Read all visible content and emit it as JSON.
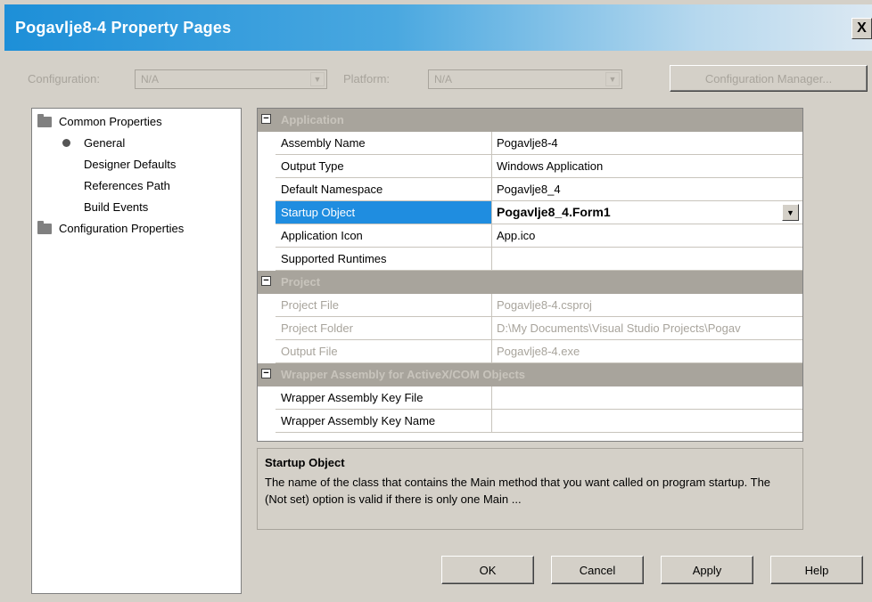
{
  "window": {
    "title": "Pogavlje8-4 Property Pages",
    "close_glyph": "X"
  },
  "toolbar": {
    "configuration_label": "Configuration:",
    "configuration_value": "N/A",
    "platform_label": "Platform:",
    "platform_value": "N/A",
    "config_manager_label": "Configuration Manager..."
  },
  "tree": {
    "items": [
      {
        "label": "Common Properties",
        "icon": "folder-icon"
      },
      {
        "label": "General",
        "icon": "bullet-icon"
      },
      {
        "label": "Designer Defaults"
      },
      {
        "label": "References Path"
      },
      {
        "label": "Build Events"
      },
      {
        "label": "Configuration Properties",
        "icon": "folder-icon"
      }
    ]
  },
  "grid": {
    "categories": [
      {
        "name": "Application",
        "expander": "⊟",
        "rows": [
          {
            "name": "Assembly Name",
            "value": "Pogavlje8-4"
          },
          {
            "name": "Output Type",
            "value": "Windows Application"
          },
          {
            "name": "Default Namespace",
            "value": "Pogavlje8_4"
          },
          {
            "name": "Startup Object",
            "value": "Pogavlje8_4.Form1",
            "selected": true
          },
          {
            "name": "Application Icon",
            "value": "App.ico"
          },
          {
            "name": "Supported Runtimes",
            "value": ""
          }
        ]
      },
      {
        "name": "Project",
        "expander": "⊟",
        "rows": [
          {
            "name": "Project File",
            "value": "Pogavlje8-4.csproj"
          },
          {
            "name": "Project Folder",
            "value": "D:\\My Documents\\Visual Studio Projects\\Pogav"
          },
          {
            "name": "Output File",
            "value": "Pogavlje8-4.exe"
          }
        ]
      },
      {
        "name": "Wrapper Assembly for ActiveX/COM Objects",
        "expander": "⊟",
        "rows": [
          {
            "name": "Wrapper Assembly Key File",
            "value": ""
          },
          {
            "name": "Wrapper Assembly Key Name",
            "value": ""
          }
        ]
      }
    ]
  },
  "description": {
    "title": "Startup Object",
    "text": "The name of the class that contains the Main method that you want called on program startup. The (Not set) option is valid if there is only one Main ..."
  },
  "buttons": {
    "ok": "OK",
    "cancel": "Cancel",
    "apply": "Apply",
    "help": "Help"
  },
  "colors": {
    "title_gradient_start": "#1d8fd8",
    "selection": "#1f8de0",
    "dialog_face": "#d4d0c8"
  }
}
